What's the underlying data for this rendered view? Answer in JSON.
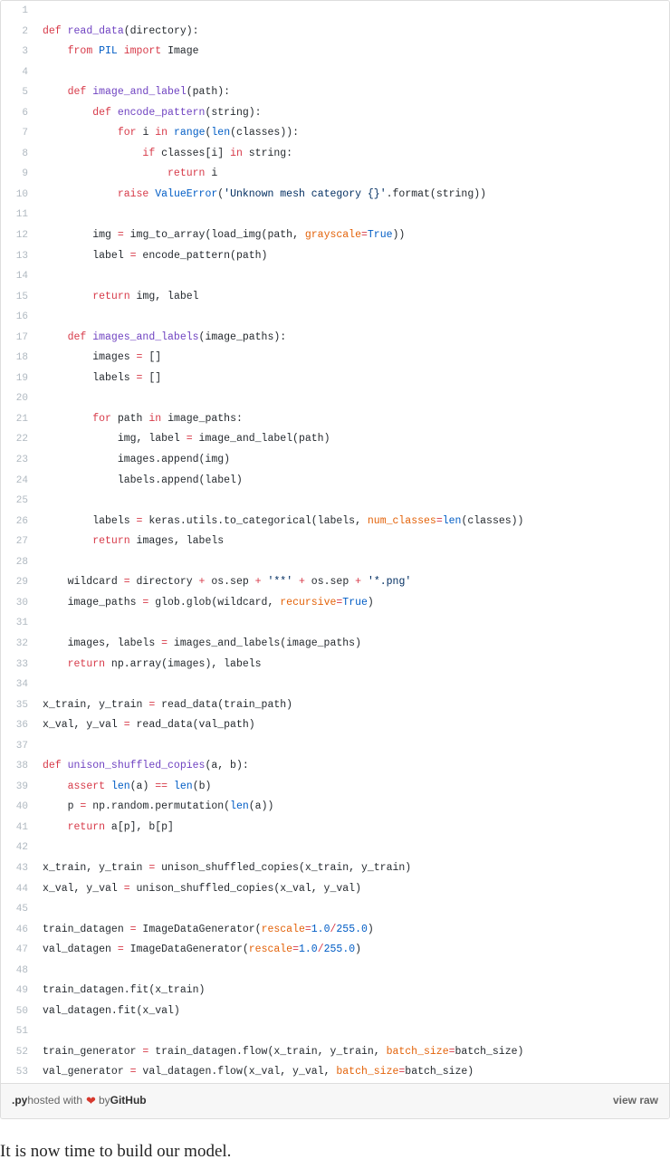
{
  "gist": {
    "footer": {
      "extension": ".py",
      "hosted_with": " hosted with ",
      "heart_icon": "heart-icon",
      "by": " by ",
      "brand": "GitHub",
      "view_raw": "view raw"
    },
    "colors": {
      "keyword": "#d73a49",
      "function_name": "#6f42c1",
      "builtin": "#005cc5",
      "string": "#032f62",
      "kwarg": "#e36209",
      "plain": "#24292e",
      "line_number": "#afb8c0",
      "footer_bg": "#f7f7f7",
      "border": "#dddddd",
      "heart": "#d7392e"
    },
    "lines": [
      {
        "n": "1",
        "tokens": []
      },
      {
        "n": "2",
        "tokens": [
          {
            "t": "",
            "c": "n"
          },
          {
            "t": "def ",
            "c": "k"
          },
          {
            "t": "read_data",
            "c": "nf"
          },
          {
            "t": "(directory):",
            "c": "n"
          }
        ]
      },
      {
        "n": "3",
        "tokens": [
          {
            "t": "    ",
            "c": "n"
          },
          {
            "t": "from ",
            "c": "k"
          },
          {
            "t": "PIL",
            "c": "nb"
          },
          {
            "t": " ",
            "c": "n"
          },
          {
            "t": "import",
            "c": "k"
          },
          {
            "t": " Image",
            "c": "n"
          }
        ]
      },
      {
        "n": "4",
        "tokens": []
      },
      {
        "n": "5",
        "tokens": [
          {
            "t": "    ",
            "c": "n"
          },
          {
            "t": "def ",
            "c": "k"
          },
          {
            "t": "image_and_label",
            "c": "nf"
          },
          {
            "t": "(path):",
            "c": "n"
          }
        ]
      },
      {
        "n": "6",
        "tokens": [
          {
            "t": "        ",
            "c": "n"
          },
          {
            "t": "def ",
            "c": "k"
          },
          {
            "t": "encode_pattern",
            "c": "nf"
          },
          {
            "t": "(string):",
            "c": "n"
          }
        ]
      },
      {
        "n": "7",
        "tokens": [
          {
            "t": "            ",
            "c": "n"
          },
          {
            "t": "for",
            "c": "k"
          },
          {
            "t": " i ",
            "c": "n"
          },
          {
            "t": "in",
            "c": "k"
          },
          {
            "t": " ",
            "c": "n"
          },
          {
            "t": "range",
            "c": "nb"
          },
          {
            "t": "(",
            "c": "n"
          },
          {
            "t": "len",
            "c": "nb"
          },
          {
            "t": "(classes)):",
            "c": "n"
          }
        ]
      },
      {
        "n": "8",
        "tokens": [
          {
            "t": "                ",
            "c": "n"
          },
          {
            "t": "if",
            "c": "k"
          },
          {
            "t": " classes[i] ",
            "c": "n"
          },
          {
            "t": "in",
            "c": "k"
          },
          {
            "t": " string:",
            "c": "n"
          }
        ]
      },
      {
        "n": "9",
        "tokens": [
          {
            "t": "                    ",
            "c": "n"
          },
          {
            "t": "return",
            "c": "k"
          },
          {
            "t": " i",
            "c": "n"
          }
        ]
      },
      {
        "n": "10",
        "tokens": [
          {
            "t": "            ",
            "c": "n"
          },
          {
            "t": "raise",
            "c": "k"
          },
          {
            "t": " ",
            "c": "n"
          },
          {
            "t": "ValueError",
            "c": "nb"
          },
          {
            "t": "(",
            "c": "n"
          },
          {
            "t": "'Unknown mesh category {}'",
            "c": "s"
          },
          {
            "t": ".format(string))",
            "c": "n"
          }
        ]
      },
      {
        "n": "11",
        "tokens": []
      },
      {
        "n": "12",
        "tokens": [
          {
            "t": "        img ",
            "c": "n"
          },
          {
            "t": "=",
            "c": "o"
          },
          {
            "t": " img_to_array(load_img(path, ",
            "c": "n"
          },
          {
            "t": "grayscale",
            "c": "kw"
          },
          {
            "t": "=",
            "c": "o"
          },
          {
            "t": "True",
            "c": "nb"
          },
          {
            "t": "))",
            "c": "n"
          }
        ]
      },
      {
        "n": "13",
        "tokens": [
          {
            "t": "        label ",
            "c": "n"
          },
          {
            "t": "=",
            "c": "o"
          },
          {
            "t": " encode_pattern(path)",
            "c": "n"
          }
        ]
      },
      {
        "n": "14",
        "tokens": []
      },
      {
        "n": "15",
        "tokens": [
          {
            "t": "        ",
            "c": "n"
          },
          {
            "t": "return",
            "c": "k"
          },
          {
            "t": " img, label",
            "c": "n"
          }
        ]
      },
      {
        "n": "16",
        "tokens": []
      },
      {
        "n": "17",
        "tokens": [
          {
            "t": "    ",
            "c": "n"
          },
          {
            "t": "def ",
            "c": "k"
          },
          {
            "t": "images_and_labels",
            "c": "nf"
          },
          {
            "t": "(image_paths):",
            "c": "n"
          }
        ]
      },
      {
        "n": "18",
        "tokens": [
          {
            "t": "        images ",
            "c": "n"
          },
          {
            "t": "=",
            "c": "o"
          },
          {
            "t": " []",
            "c": "n"
          }
        ]
      },
      {
        "n": "19",
        "tokens": [
          {
            "t": "        labels ",
            "c": "n"
          },
          {
            "t": "=",
            "c": "o"
          },
          {
            "t": " []",
            "c": "n"
          }
        ]
      },
      {
        "n": "20",
        "tokens": []
      },
      {
        "n": "21",
        "tokens": [
          {
            "t": "        ",
            "c": "n"
          },
          {
            "t": "for",
            "c": "k"
          },
          {
            "t": " path ",
            "c": "n"
          },
          {
            "t": "in",
            "c": "k"
          },
          {
            "t": " image_paths:",
            "c": "n"
          }
        ]
      },
      {
        "n": "22",
        "tokens": [
          {
            "t": "            img, label ",
            "c": "n"
          },
          {
            "t": "=",
            "c": "o"
          },
          {
            "t": " image_and_label(path)",
            "c": "n"
          }
        ]
      },
      {
        "n": "23",
        "tokens": [
          {
            "t": "            images.append(img)",
            "c": "n"
          }
        ]
      },
      {
        "n": "24",
        "tokens": [
          {
            "t": "            labels.append(label)",
            "c": "n"
          }
        ]
      },
      {
        "n": "25",
        "tokens": []
      },
      {
        "n": "26",
        "tokens": [
          {
            "t": "        labels ",
            "c": "n"
          },
          {
            "t": "=",
            "c": "o"
          },
          {
            "t": " keras.utils.to_categorical(labels, ",
            "c": "n"
          },
          {
            "t": "num_classes",
            "c": "kw"
          },
          {
            "t": "=",
            "c": "o"
          },
          {
            "t": "len",
            "c": "nb"
          },
          {
            "t": "(classes))",
            "c": "n"
          }
        ]
      },
      {
        "n": "27",
        "tokens": [
          {
            "t": "        ",
            "c": "n"
          },
          {
            "t": "return",
            "c": "k"
          },
          {
            "t": " images, labels",
            "c": "n"
          }
        ]
      },
      {
        "n": "28",
        "tokens": []
      },
      {
        "n": "29",
        "tokens": [
          {
            "t": "    wildcard ",
            "c": "n"
          },
          {
            "t": "=",
            "c": "o"
          },
          {
            "t": " directory ",
            "c": "n"
          },
          {
            "t": "+",
            "c": "o"
          },
          {
            "t": " os.sep ",
            "c": "n"
          },
          {
            "t": "+",
            "c": "o"
          },
          {
            "t": " ",
            "c": "n"
          },
          {
            "t": "'**'",
            "c": "s"
          },
          {
            "t": " ",
            "c": "n"
          },
          {
            "t": "+",
            "c": "o"
          },
          {
            "t": " os.sep ",
            "c": "n"
          },
          {
            "t": "+",
            "c": "o"
          },
          {
            "t": " ",
            "c": "n"
          },
          {
            "t": "'*.png'",
            "c": "s"
          }
        ]
      },
      {
        "n": "30",
        "tokens": [
          {
            "t": "    image_paths ",
            "c": "n"
          },
          {
            "t": "=",
            "c": "o"
          },
          {
            "t": " glob.glob(wildcard, ",
            "c": "n"
          },
          {
            "t": "recursive",
            "c": "kw"
          },
          {
            "t": "=",
            "c": "o"
          },
          {
            "t": "True",
            "c": "nb"
          },
          {
            "t": ")",
            "c": "n"
          }
        ]
      },
      {
        "n": "31",
        "tokens": []
      },
      {
        "n": "32",
        "tokens": [
          {
            "t": "    images, labels ",
            "c": "n"
          },
          {
            "t": "=",
            "c": "o"
          },
          {
            "t": " images_and_labels(image_paths)",
            "c": "n"
          }
        ]
      },
      {
        "n": "33",
        "tokens": [
          {
            "t": "    ",
            "c": "n"
          },
          {
            "t": "return",
            "c": "k"
          },
          {
            "t": " np.array(images), labels",
            "c": "n"
          }
        ]
      },
      {
        "n": "34",
        "tokens": []
      },
      {
        "n": "35",
        "tokens": [
          {
            "t": "x_train, y_train ",
            "c": "n"
          },
          {
            "t": "=",
            "c": "o"
          },
          {
            "t": " read_data(train_path)",
            "c": "n"
          }
        ]
      },
      {
        "n": "36",
        "tokens": [
          {
            "t": "x_val, y_val ",
            "c": "n"
          },
          {
            "t": "=",
            "c": "o"
          },
          {
            "t": " read_data(val_path)",
            "c": "n"
          }
        ]
      },
      {
        "n": "37",
        "tokens": []
      },
      {
        "n": "38",
        "tokens": [
          {
            "t": "def ",
            "c": "k"
          },
          {
            "t": "unison_shuffled_copies",
            "c": "nf"
          },
          {
            "t": "(a, b):",
            "c": "n"
          }
        ]
      },
      {
        "n": "39",
        "tokens": [
          {
            "t": "    ",
            "c": "n"
          },
          {
            "t": "assert",
            "c": "k"
          },
          {
            "t": " ",
            "c": "n"
          },
          {
            "t": "len",
            "c": "nb"
          },
          {
            "t": "(a) ",
            "c": "n"
          },
          {
            "t": "==",
            "c": "o"
          },
          {
            "t": " ",
            "c": "n"
          },
          {
            "t": "len",
            "c": "nb"
          },
          {
            "t": "(b)",
            "c": "n"
          }
        ]
      },
      {
        "n": "40",
        "tokens": [
          {
            "t": "    p ",
            "c": "n"
          },
          {
            "t": "=",
            "c": "o"
          },
          {
            "t": " np.random.permutation(",
            "c": "n"
          },
          {
            "t": "len",
            "c": "nb"
          },
          {
            "t": "(a))",
            "c": "n"
          }
        ]
      },
      {
        "n": "41",
        "tokens": [
          {
            "t": "    ",
            "c": "n"
          },
          {
            "t": "return",
            "c": "k"
          },
          {
            "t": " a[p], b[p]",
            "c": "n"
          }
        ]
      },
      {
        "n": "42",
        "tokens": []
      },
      {
        "n": "43",
        "tokens": [
          {
            "t": "x_train, y_train ",
            "c": "n"
          },
          {
            "t": "=",
            "c": "o"
          },
          {
            "t": " unison_shuffled_copies(x_train, y_train)",
            "c": "n"
          }
        ]
      },
      {
        "n": "44",
        "tokens": [
          {
            "t": "x_val, y_val ",
            "c": "n"
          },
          {
            "t": "=",
            "c": "o"
          },
          {
            "t": " unison_shuffled_copies(x_val, y_val)",
            "c": "n"
          }
        ]
      },
      {
        "n": "45",
        "tokens": []
      },
      {
        "n": "46",
        "tokens": [
          {
            "t": "train_datagen ",
            "c": "n"
          },
          {
            "t": "=",
            "c": "o"
          },
          {
            "t": " ImageDataGenerator(",
            "c": "n"
          },
          {
            "t": "rescale",
            "c": "kw"
          },
          {
            "t": "=",
            "c": "o"
          },
          {
            "t": "1.0",
            "c": "nb"
          },
          {
            "t": "/",
            "c": "o"
          },
          {
            "t": "255.0",
            "c": "nb"
          },
          {
            "t": ")",
            "c": "n"
          }
        ]
      },
      {
        "n": "47",
        "tokens": [
          {
            "t": "val_datagen ",
            "c": "n"
          },
          {
            "t": "=",
            "c": "o"
          },
          {
            "t": " ImageDataGenerator(",
            "c": "n"
          },
          {
            "t": "rescale",
            "c": "kw"
          },
          {
            "t": "=",
            "c": "o"
          },
          {
            "t": "1.0",
            "c": "nb"
          },
          {
            "t": "/",
            "c": "o"
          },
          {
            "t": "255.0",
            "c": "nb"
          },
          {
            "t": ")",
            "c": "n"
          }
        ]
      },
      {
        "n": "48",
        "tokens": []
      },
      {
        "n": "49",
        "tokens": [
          {
            "t": "train_datagen.fit(x_train)",
            "c": "n"
          }
        ]
      },
      {
        "n": "50",
        "tokens": [
          {
            "t": "val_datagen.fit(x_val)",
            "c": "n"
          }
        ]
      },
      {
        "n": "51",
        "tokens": []
      },
      {
        "n": "52",
        "tokens": [
          {
            "t": "train_generator ",
            "c": "n"
          },
          {
            "t": "=",
            "c": "o"
          },
          {
            "t": " train_datagen.flow(x_train, y_train, ",
            "c": "n"
          },
          {
            "t": "batch_size",
            "c": "kw"
          },
          {
            "t": "=",
            "c": "o"
          },
          {
            "t": "batch_size)",
            "c": "n"
          }
        ]
      },
      {
        "n": "53",
        "tokens": [
          {
            "t": "val_generator ",
            "c": "n"
          },
          {
            "t": "=",
            "c": "o"
          },
          {
            "t": " val_datagen.flow(x_val, y_val, ",
            "c": "n"
          },
          {
            "t": "batch_size",
            "c": "kw"
          },
          {
            "t": "=",
            "c": "o"
          },
          {
            "t": "batch_size)",
            "c": "n"
          }
        ]
      }
    ]
  },
  "page": {
    "following_paragraph": "It is now time to build our model."
  }
}
